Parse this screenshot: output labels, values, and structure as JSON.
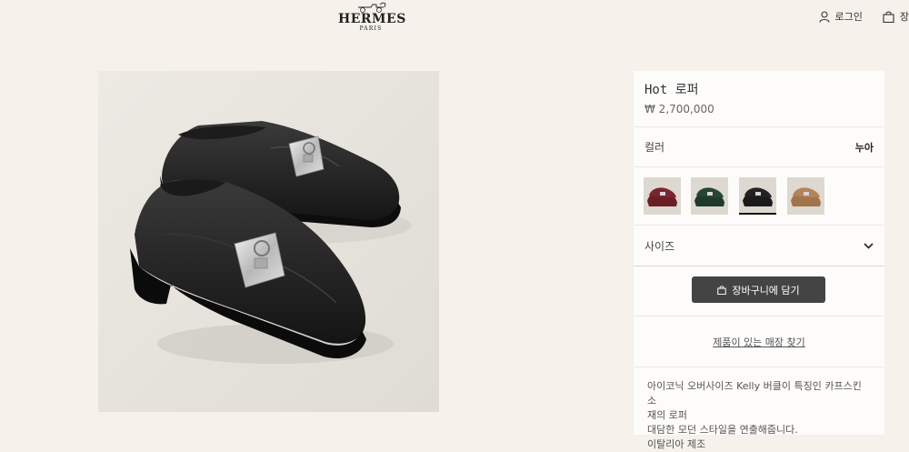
{
  "header": {
    "brand": "HERMES",
    "brand_sub": "PARIS",
    "login_label": "로그인",
    "cart_label": "장",
    "icons": [
      "user-icon",
      "shopping-bag-icon"
    ]
  },
  "product": {
    "name": "Hot 로퍼",
    "price": "₩ 2,700,000",
    "color_label": "컬러",
    "color_value": "누아",
    "swatches": [
      {
        "name": "burgundy",
        "color": "#6b1e26"
      },
      {
        "name": "dark-green",
        "color": "#1f3a2a"
      },
      {
        "name": "black",
        "color": "#1a1a1a",
        "selected": true
      },
      {
        "name": "tan",
        "color": "#a2744c"
      }
    ],
    "size_label": "사이즈",
    "add_to_cart_label": "장바구니에 담기",
    "store_link_label": "제품이 있는 매장 찾기",
    "description_lines": [
      "아이코닉 오버사이즈 Kelly 버클이 특징인 카프스킨 소",
      "재의 로퍼",
      "대담한 모던 스타일을 연출해줍니다.",
      "이탈리아 제조"
    ]
  },
  "colors": {
    "background": "#f6f1eb",
    "panel": "#fdfcfa",
    "button": "#444444",
    "image_bg": "#e8e7e0"
  }
}
